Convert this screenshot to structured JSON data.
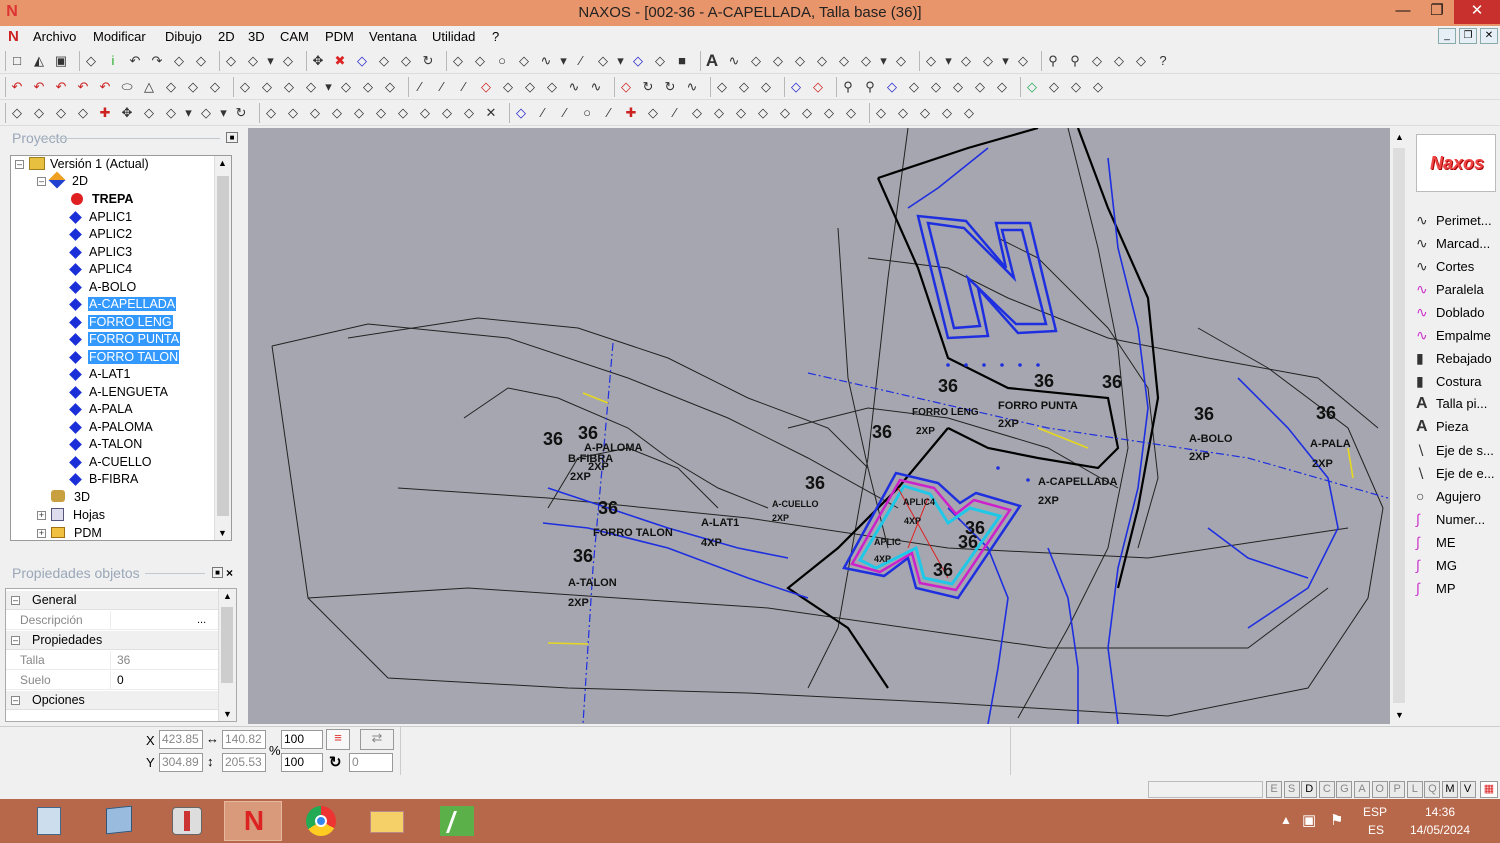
{
  "window": {
    "title": "NAXOS - [002-36 - A-CAPELLADA, Talla base (36)]"
  },
  "menu": [
    "Archivo",
    "Modificar",
    "Dibujo",
    "2D",
    "3D",
    "CAM",
    "PDM",
    "Ventana",
    "Utilidad",
    "?"
  ],
  "project": {
    "title": "Proyecto",
    "version": "Versión 1 (Actual)",
    "node_2d": "2D",
    "pieces": [
      {
        "label": "TREPA",
        "marker": "red-dot",
        "bold": true,
        "selected": false
      },
      {
        "label": "APLIC1",
        "marker": "diamond",
        "selected": false
      },
      {
        "label": "APLIC2",
        "marker": "diamond",
        "selected": false
      },
      {
        "label": "APLIC3",
        "marker": "diamond",
        "selected": false
      },
      {
        "label": "APLIC4",
        "marker": "diamond",
        "selected": false
      },
      {
        "label": "A-BOLO",
        "marker": "diamond",
        "selected": false
      },
      {
        "label": "A-CAPELLADA",
        "marker": "diamond",
        "selected": true
      },
      {
        "label": "FORRO LENG",
        "marker": "diamond",
        "selected": true
      },
      {
        "label": "FORRO PUNTA",
        "marker": "diamond",
        "selected": true
      },
      {
        "label": "FORRO TALON",
        "marker": "diamond",
        "selected": true
      },
      {
        "label": "A-LAT1",
        "marker": "diamond",
        "selected": false
      },
      {
        "label": "A-LENGUETA",
        "marker": "diamond",
        "selected": false
      },
      {
        "label": "A-PALA",
        "marker": "diamond",
        "selected": false
      },
      {
        "label": "A-PALOMA",
        "marker": "diamond",
        "selected": false
      },
      {
        "label": "A-TALON",
        "marker": "diamond",
        "selected": false
      },
      {
        "label": "A-CUELLO",
        "marker": "diamond",
        "selected": false
      },
      {
        "label": "B-FIBRA",
        "marker": "diamond",
        "selected": false
      }
    ],
    "node_3d": "3D",
    "node_hojas": "Hojas",
    "node_pdm": "PDM"
  },
  "properties": {
    "title": "Propiedades objetos",
    "sections": {
      "general": "General",
      "propiedades": "Propiedades",
      "opciones": "Opciones"
    },
    "rows": {
      "descripcion": {
        "key": "Descripción",
        "value": "",
        "button": "..."
      },
      "talla": {
        "key": "Talla",
        "value": "36"
      },
      "suelo": {
        "key": "Suelo",
        "value": "0"
      }
    }
  },
  "canvas_labels": {
    "size": "36",
    "pieces": [
      {
        "name": "A-PALOMA",
        "qty": "2XP"
      },
      {
        "name": "B-FIBRA",
        "qty": "2XP"
      },
      {
        "name": "FORRO TALON",
        "qty": ""
      },
      {
        "name": "A-TALON",
        "qty": "2XP"
      },
      {
        "name": "A-LAT1",
        "qty": "4XP"
      },
      {
        "name": "A-CUELLO",
        "qty": "2XP"
      },
      {
        "name": "FORRO PUNTA",
        "qty": "2XP"
      },
      {
        "name": "FORRO LENG",
        "qty": "2XP"
      },
      {
        "name": "A-CAPELLADA",
        "qty": "2XP"
      },
      {
        "name": "A-BOLO",
        "qty": "2XP"
      },
      {
        "name": "A-PALA",
        "qty": "2XP"
      },
      {
        "name": "APLIC4",
        "qty": "4XP"
      },
      {
        "name": "APLIC",
        "qty": "4XP"
      }
    ]
  },
  "right_tools": [
    {
      "label": "Perimet...",
      "icon": "curve-icon"
    },
    {
      "label": "Marcad...",
      "icon": "curve-icon"
    },
    {
      "label": "Cortes",
      "icon": "curve-icon"
    },
    {
      "label": "Paralela",
      "icon": "parallel-icon"
    },
    {
      "label": "Doblado",
      "icon": "fold-icon"
    },
    {
      "label": "Empalme",
      "icon": "join-icon"
    },
    {
      "label": "Rebajado",
      "icon": "skive-icon"
    },
    {
      "label": "Costura",
      "icon": "seam-icon"
    },
    {
      "label": "Talla pi...",
      "icon": "text-a-icon"
    },
    {
      "label": "Pieza",
      "icon": "text-a-icon"
    },
    {
      "label": "Eje de s...",
      "icon": "axis-icon"
    },
    {
      "label": "Eje de e...",
      "icon": "axis-icon"
    },
    {
      "label": "Agujero",
      "icon": "hole-icon"
    },
    {
      "label": "Numer...",
      "icon": "number-icon"
    },
    {
      "label": "ME",
      "icon": "mark-icon"
    },
    {
      "label": "MG",
      "icon": "mark-icon"
    },
    {
      "label": "MP",
      "icon": "mark-icon"
    }
  ],
  "logo_text": "Naxos",
  "status": {
    "x_label": "X",
    "y_label": "Y",
    "x": "423.85",
    "y": "304.89",
    "width": "140.82",
    "height": "205.53",
    "percent_symbol": "%",
    "scale_x": "100",
    "scale_y": "100",
    "rotation": "0",
    "snap_letters": [
      "E",
      "S",
      "D",
      "C",
      "G",
      "A",
      "O",
      "P",
      "L",
      "Q",
      "M",
      "V"
    ]
  },
  "taskbar": {
    "lang": "ESP",
    "lang_sub": "ES",
    "time": "14:36",
    "date": "14/05/2024"
  },
  "colors": {
    "titlebar": "#e8956b",
    "canvas": "#a6a6b0",
    "selection": "#3399ff",
    "taskbar": "#b8684a"
  }
}
